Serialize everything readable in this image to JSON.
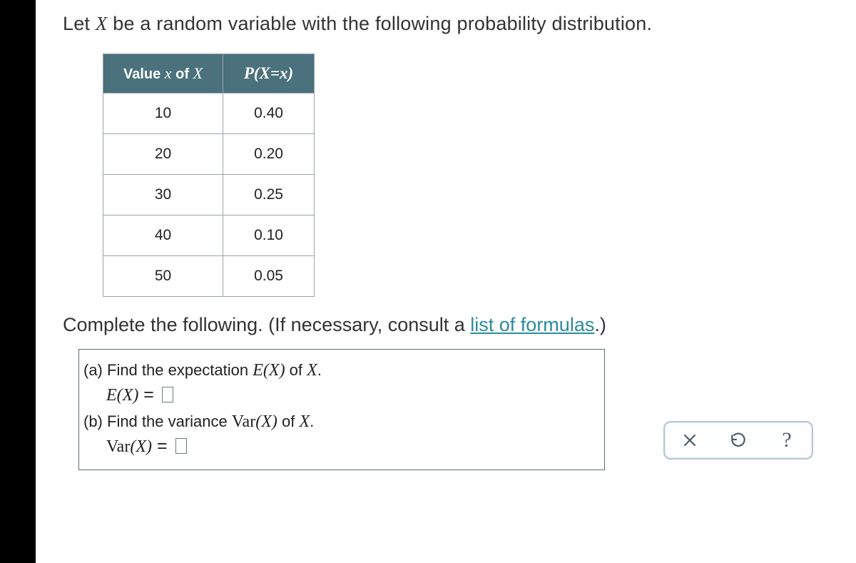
{
  "prompt": {
    "prefix": "Let ",
    "var": "X",
    "suffix": " be a random variable with the following probability distribution."
  },
  "table": {
    "header": {
      "value_prefix": "Value ",
      "value_var": "x",
      "value_suffix": " of ",
      "value_of_var": "X",
      "prob": "P(X=x)"
    },
    "rows": [
      {
        "x": "10",
        "p": "0.40"
      },
      {
        "x": "20",
        "p": "0.20"
      },
      {
        "x": "30",
        "p": "0.25"
      },
      {
        "x": "40",
        "p": "0.10"
      },
      {
        "x": "50",
        "p": "0.05"
      }
    ]
  },
  "instruction": {
    "prefix": "Complete the following. (If necessary, consult a ",
    "link": "list of formulas",
    "suffix": ".)"
  },
  "parts": {
    "a": {
      "label": "(a) Find the expectation ",
      "expr": "E(X)",
      "of": " of ",
      "var": "X",
      "period": ".",
      "eq_lhs": "E(X)",
      "eq_op": " = "
    },
    "b": {
      "label": "(b) Find the variance ",
      "expr": "Var(X)",
      "of": " of ",
      "var": "X",
      "period": ".",
      "eq_lhs": "Var(X)",
      "eq_op": " = "
    }
  },
  "chart_data": {
    "type": "table",
    "title": "Probability distribution of X",
    "columns": [
      "x",
      "P(X=x)"
    ],
    "rows": [
      [
        10,
        0.4
      ],
      [
        20,
        0.2
      ],
      [
        30,
        0.25
      ],
      [
        40,
        0.1
      ],
      [
        50,
        0.05
      ]
    ]
  }
}
